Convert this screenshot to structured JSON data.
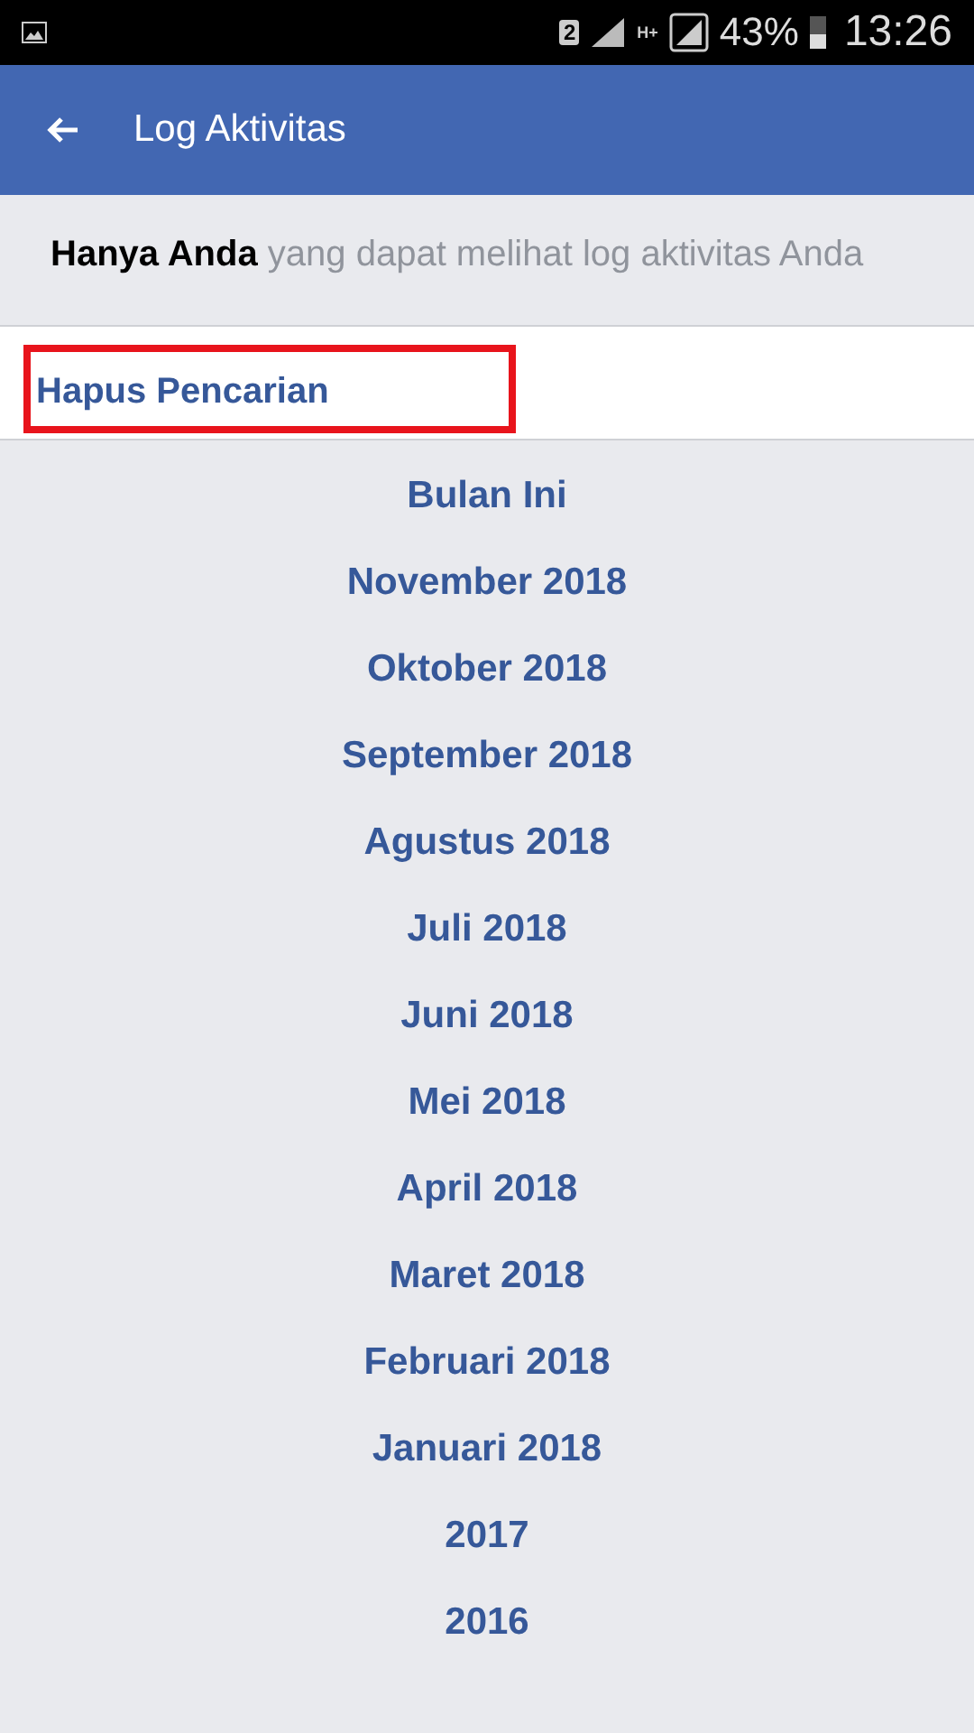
{
  "status_bar": {
    "sim": "2",
    "network": "H+",
    "battery": "43%",
    "time": "13:26"
  },
  "app_bar": {
    "title": "Log Aktivitas"
  },
  "notice": "**Hanya Anda** yang dapat melihat log aktivitas Anda",
  "clear_search": {
    "label": "Hapus Pencarian",
    "highlighted": true
  },
  "periods": [
    "Bulan Ini",
    "November 2018",
    "Oktober 2018",
    "September 2018",
    "Agustus 2018",
    "Juli 2018",
    "Juni 2018",
    "Mei 2018",
    "April 2018",
    "Maret 2018",
    "Februari 2018",
    "Januari 2018",
    "2017",
    "2016"
  ]
}
